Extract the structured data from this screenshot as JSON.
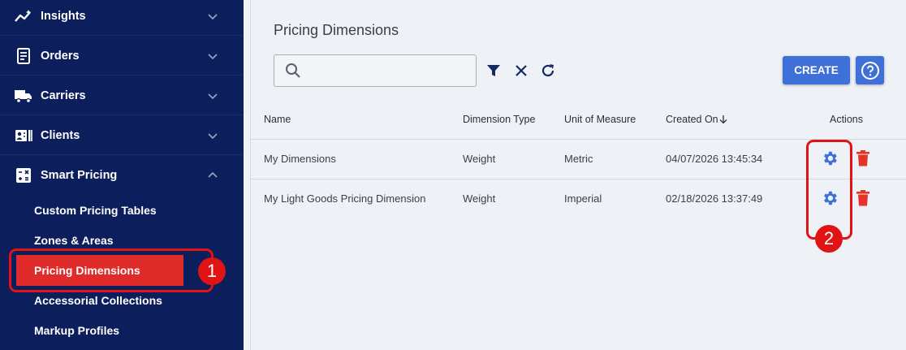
{
  "sidebar": {
    "items": [
      {
        "label": "Insights",
        "icon": "insights-icon"
      },
      {
        "label": "Orders",
        "icon": "orders-icon"
      },
      {
        "label": "Carriers",
        "icon": "truck-icon"
      },
      {
        "label": "Clients",
        "icon": "clients-icon"
      },
      {
        "label": "Smart Pricing",
        "icon": "calculator-icon"
      }
    ],
    "sub_items": [
      {
        "label": "Custom Pricing Tables"
      },
      {
        "label": "Zones & Areas"
      },
      {
        "label": "Pricing Dimensions",
        "active": true
      },
      {
        "label": "Accessorial Collections"
      },
      {
        "label": "Markup Profiles"
      }
    ]
  },
  "annotations": {
    "one": "1",
    "two": "2"
  },
  "main": {
    "title": "Pricing Dimensions",
    "search_placeholder": "",
    "create_label": "CREATE",
    "columns": [
      "Name",
      "Dimension Type",
      "Unit of Measure",
      "Created On",
      "Actions"
    ],
    "rows": [
      {
        "name": "My Dimensions",
        "type": "Weight",
        "unit": "Metric",
        "created": "04/07/2026 13:45:34"
      },
      {
        "name": "My Light Goods Pricing Dimension",
        "type": "Weight",
        "unit": "Imperial",
        "created": "02/18/2026 13:37:49"
      }
    ]
  },
  "colors": {
    "sidebar": "#0c1f5c",
    "accent": "#3f6fd8",
    "active": "#e02b2b",
    "delete": "#e5332a",
    "annotation": "#e01414"
  }
}
